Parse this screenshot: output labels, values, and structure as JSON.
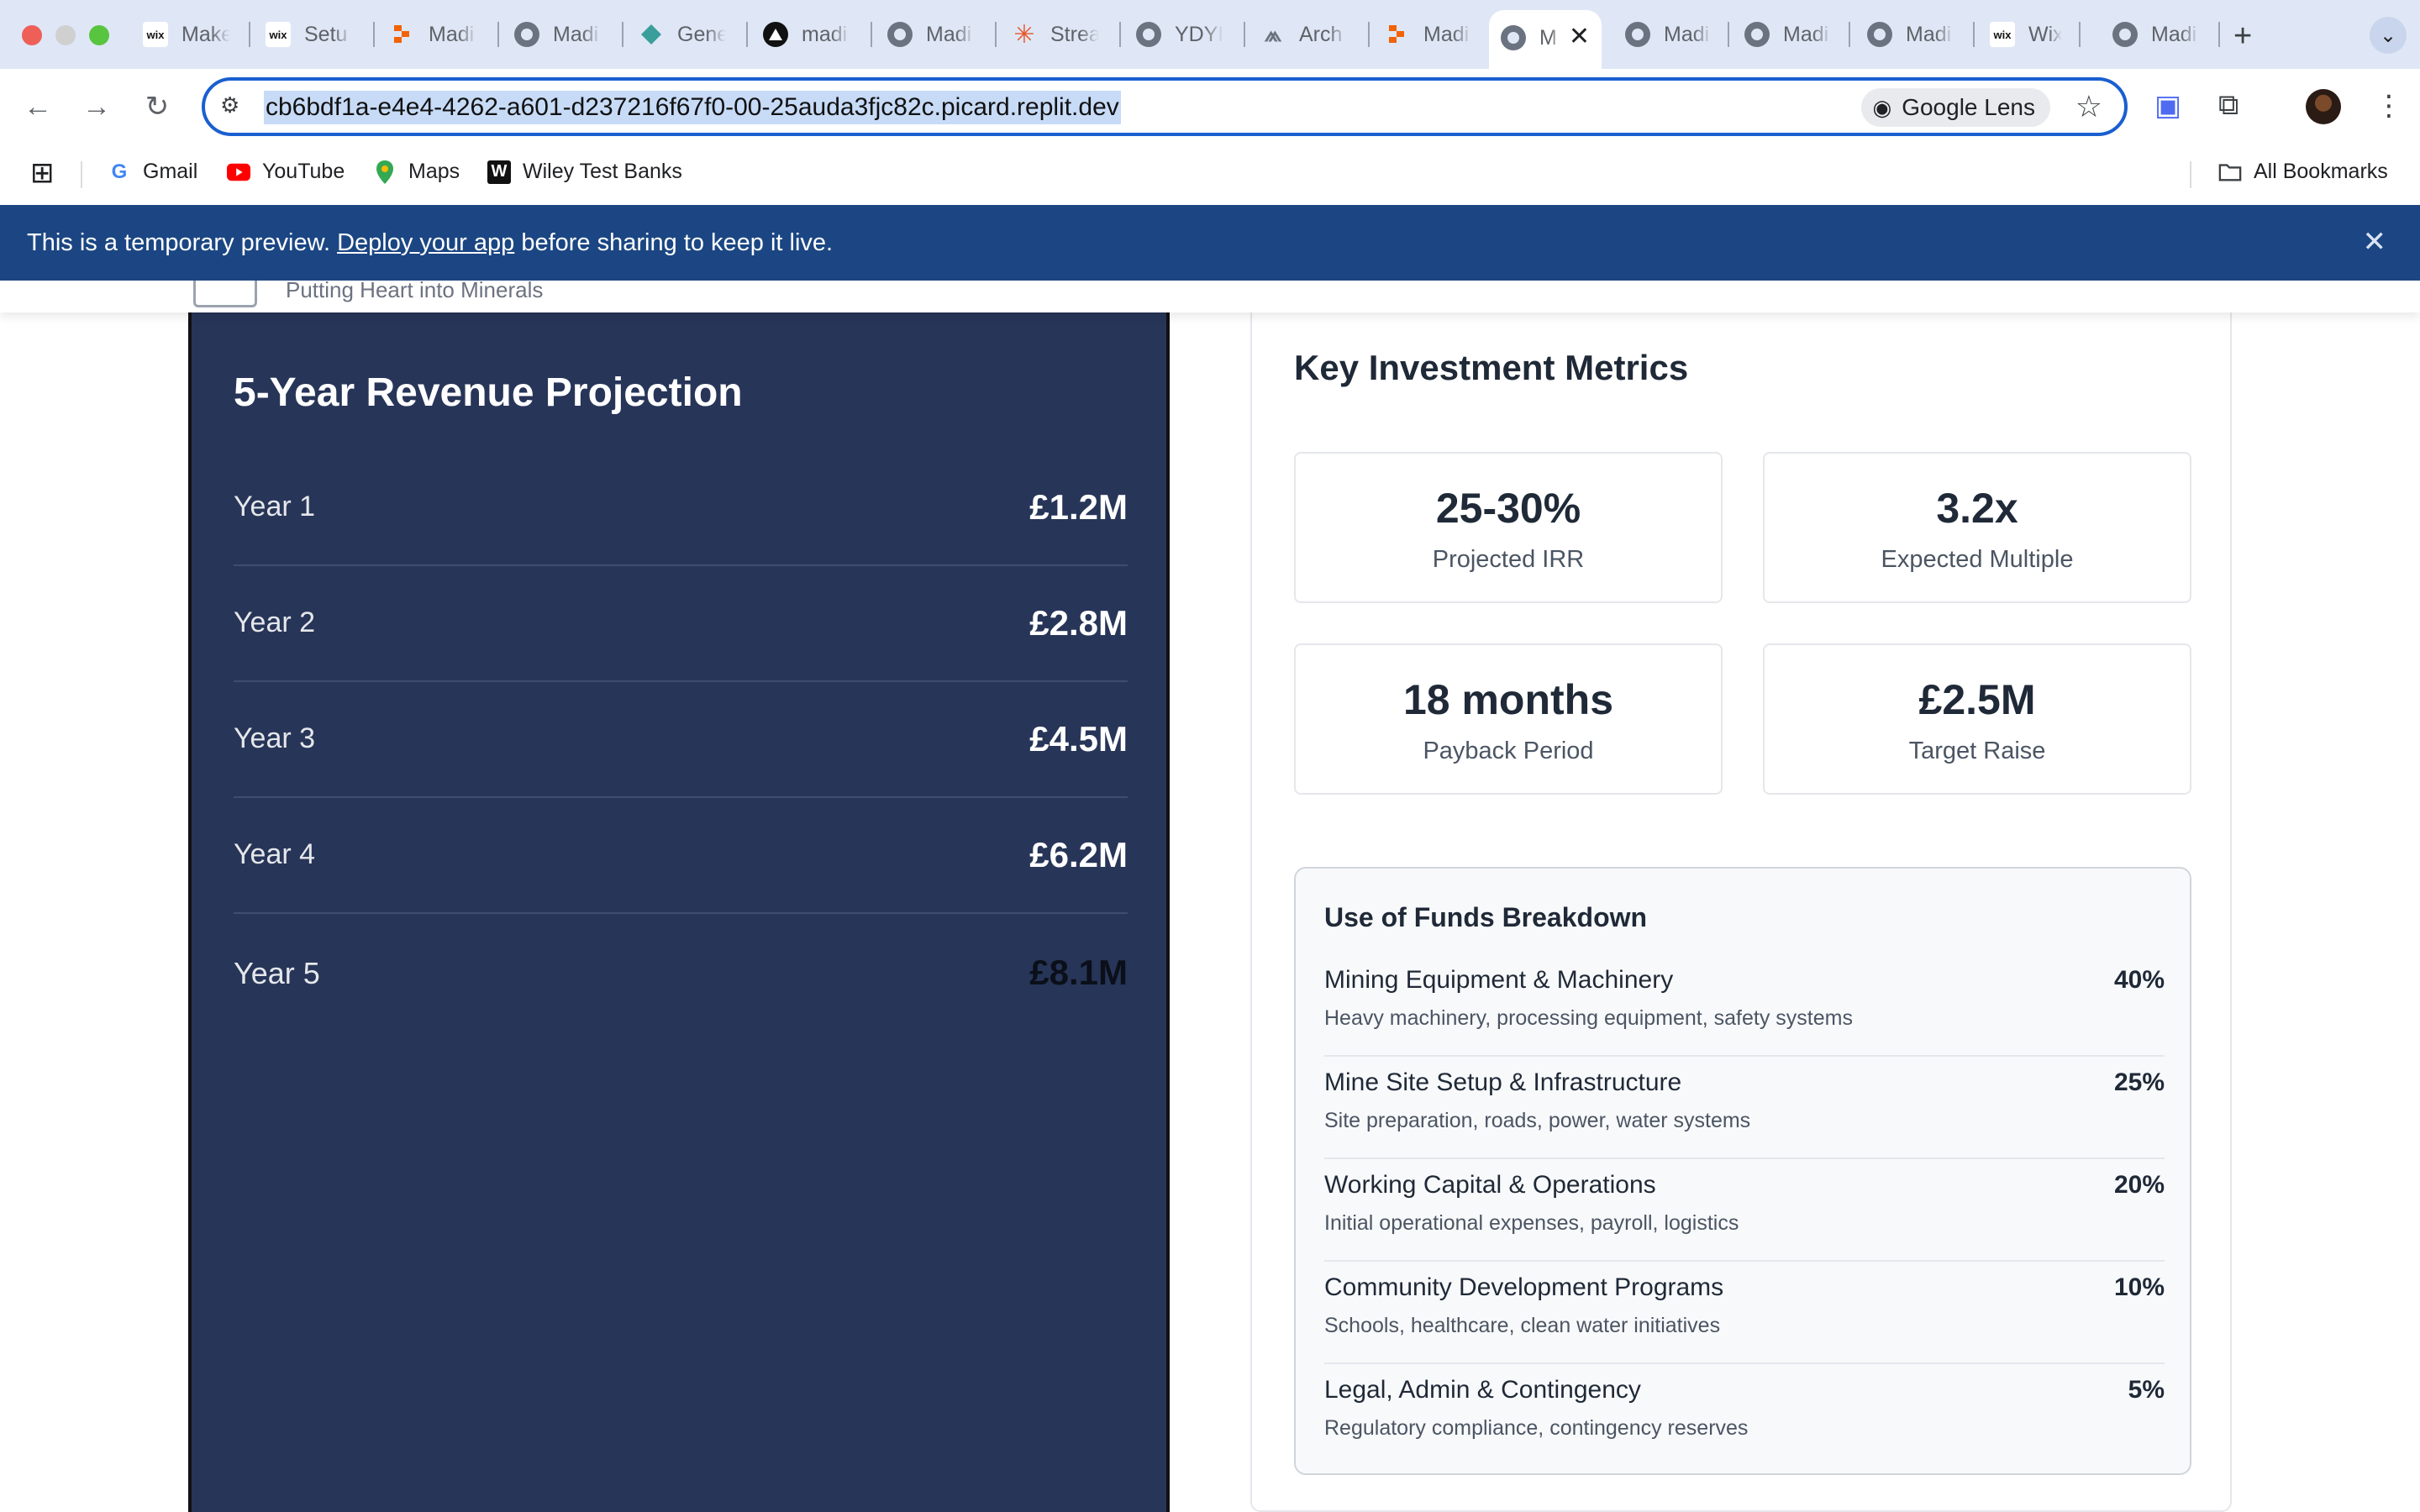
{
  "browser": {
    "tabs": [
      {
        "title": "Make",
        "icon": "wix-icon"
      },
      {
        "title": "Setu",
        "icon": "wix-icon"
      },
      {
        "title": "Madi",
        "icon": "replit-icon"
      },
      {
        "title": "Madi",
        "icon": "globe-icon"
      },
      {
        "title": "Gene",
        "icon": "gemini-icon"
      },
      {
        "title": "madi",
        "icon": "triangle-logo-icon"
      },
      {
        "title": "Madi",
        "icon": "globe-icon"
      },
      {
        "title": "Strea",
        "icon": "starburst-icon"
      },
      {
        "title": "YDYI",
        "icon": "globe-icon"
      },
      {
        "title": "Arch",
        "icon": "arch-logo-icon"
      },
      {
        "title": "Madi",
        "icon": "replit-icon"
      },
      {
        "title": "M",
        "icon": "globe-icon",
        "active": true
      },
      {
        "title": "Madi",
        "icon": "globe-icon"
      },
      {
        "title": "Madi",
        "icon": "globe-icon"
      },
      {
        "title": "Madi",
        "icon": "globe-icon"
      },
      {
        "title": "Wix",
        "icon": "wix-icon"
      },
      {
        "title": "Madi",
        "icon": "globe-icon"
      }
    ],
    "url": "cb6bdf1a-e4e4-4262-a601-d237216f67f0-00-25auda3fjc82c.picard.replit.dev",
    "lens_label": "Google Lens",
    "bookmarks": [
      {
        "label": "Gmail",
        "icon": "google-icon"
      },
      {
        "label": "YouTube",
        "icon": "youtube-icon"
      },
      {
        "label": "Maps",
        "icon": "maps-pin-icon"
      },
      {
        "label": "Wiley Test Banks",
        "icon": "wiley-icon"
      }
    ],
    "all_bookmarks_label": "All Bookmarks"
  },
  "banner": {
    "prefix": "This is a temporary preview.",
    "link": "Deploy your app",
    "suffix": "before sharing to keep it live."
  },
  "header": {
    "tagline": "Putting Heart into Minerals"
  },
  "revenue": {
    "title": "5-Year Revenue Projection",
    "rows": [
      {
        "label": "Year 1",
        "value": "£1.2M"
      },
      {
        "label": "Year 2",
        "value": "£2.8M"
      },
      {
        "label": "Year 3",
        "value": "£4.5M"
      },
      {
        "label": "Year 4",
        "value": "£6.2M"
      },
      {
        "label": "Year 5",
        "value": "£8.1M"
      }
    ]
  },
  "metrics": {
    "title": "Key Investment Metrics",
    "items": [
      {
        "value": "25-30%",
        "label": "Projected IRR"
      },
      {
        "value": "3.2x",
        "label": "Expected Multiple"
      },
      {
        "value": "18 months",
        "label": "Payback Period"
      },
      {
        "value": "£2.5M",
        "label": "Target Raise"
      }
    ]
  },
  "funds": {
    "title": "Use of Funds Breakdown",
    "rows": [
      {
        "name": "Mining Equipment & Machinery",
        "desc": "Heavy machinery, processing equipment, safety systems",
        "pct": "40%"
      },
      {
        "name": "Mine Site Setup & Infrastructure",
        "desc": "Site preparation, roads, power, water systems",
        "pct": "25%"
      },
      {
        "name": "Working Capital & Operations",
        "desc": "Initial operational expenses, payroll, logistics",
        "pct": "20%"
      },
      {
        "name": "Community Development Programs",
        "desc": "Schools, healthcare, clean water initiatives",
        "pct": "10%"
      },
      {
        "name": "Legal, Admin & Contingency",
        "desc": "Regulatory compliance, contingency reserves",
        "pct": "5%"
      }
    ]
  },
  "colors": {
    "banner_bg": "#1b4683",
    "revenue_card_bg": "#273558",
    "omnibox_focus": "#1a5fd0"
  }
}
